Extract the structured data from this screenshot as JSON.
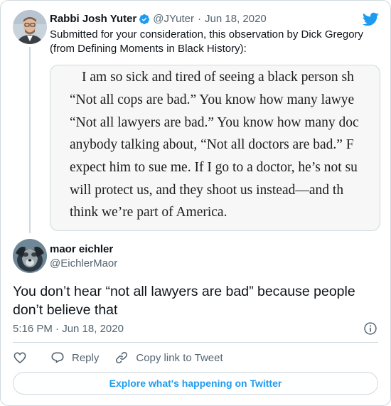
{
  "parent_tweet": {
    "name": "Rabbi Josh Yuter",
    "handle": "@JYuter",
    "separator": "·",
    "date": "Jun 18, 2020",
    "verified": true,
    "text": "Submitted for your consideration, this observation by Dick Gregory (from Defining Moments in Black History):",
    "image_lines": [
      "I am so sick and tired of seeing a black person sh",
      "“Not all cops are bad.” You know how many lawye",
      "“Not all lawyers are bad.” You know how many doc",
      "anybody talking about, “Not all doctors are bad.” F",
      "expect him to sue me. If I go to a doctor, he’s not su",
      "will protect us, and they shoot us instead—and th",
      "think we’re part of America."
    ]
  },
  "reply_tweet": {
    "name": "maor eichler",
    "handle": "@EichlerMaor",
    "text": "You don’t hear “not all lawyers are bad” because people don’t believe that",
    "timestamp": "5:16 PM · Jun 18, 2020"
  },
  "actions": {
    "like_icon": "heart-icon",
    "reply_label": "Reply",
    "copy_link_label": "Copy link to Tweet"
  },
  "explore_button": "Explore what's happening on Twitter",
  "colors": {
    "twitter_blue": "#1d9bf0",
    "text_primary": "#0f1419",
    "text_muted": "#536471",
    "border": "#cfd9de"
  }
}
